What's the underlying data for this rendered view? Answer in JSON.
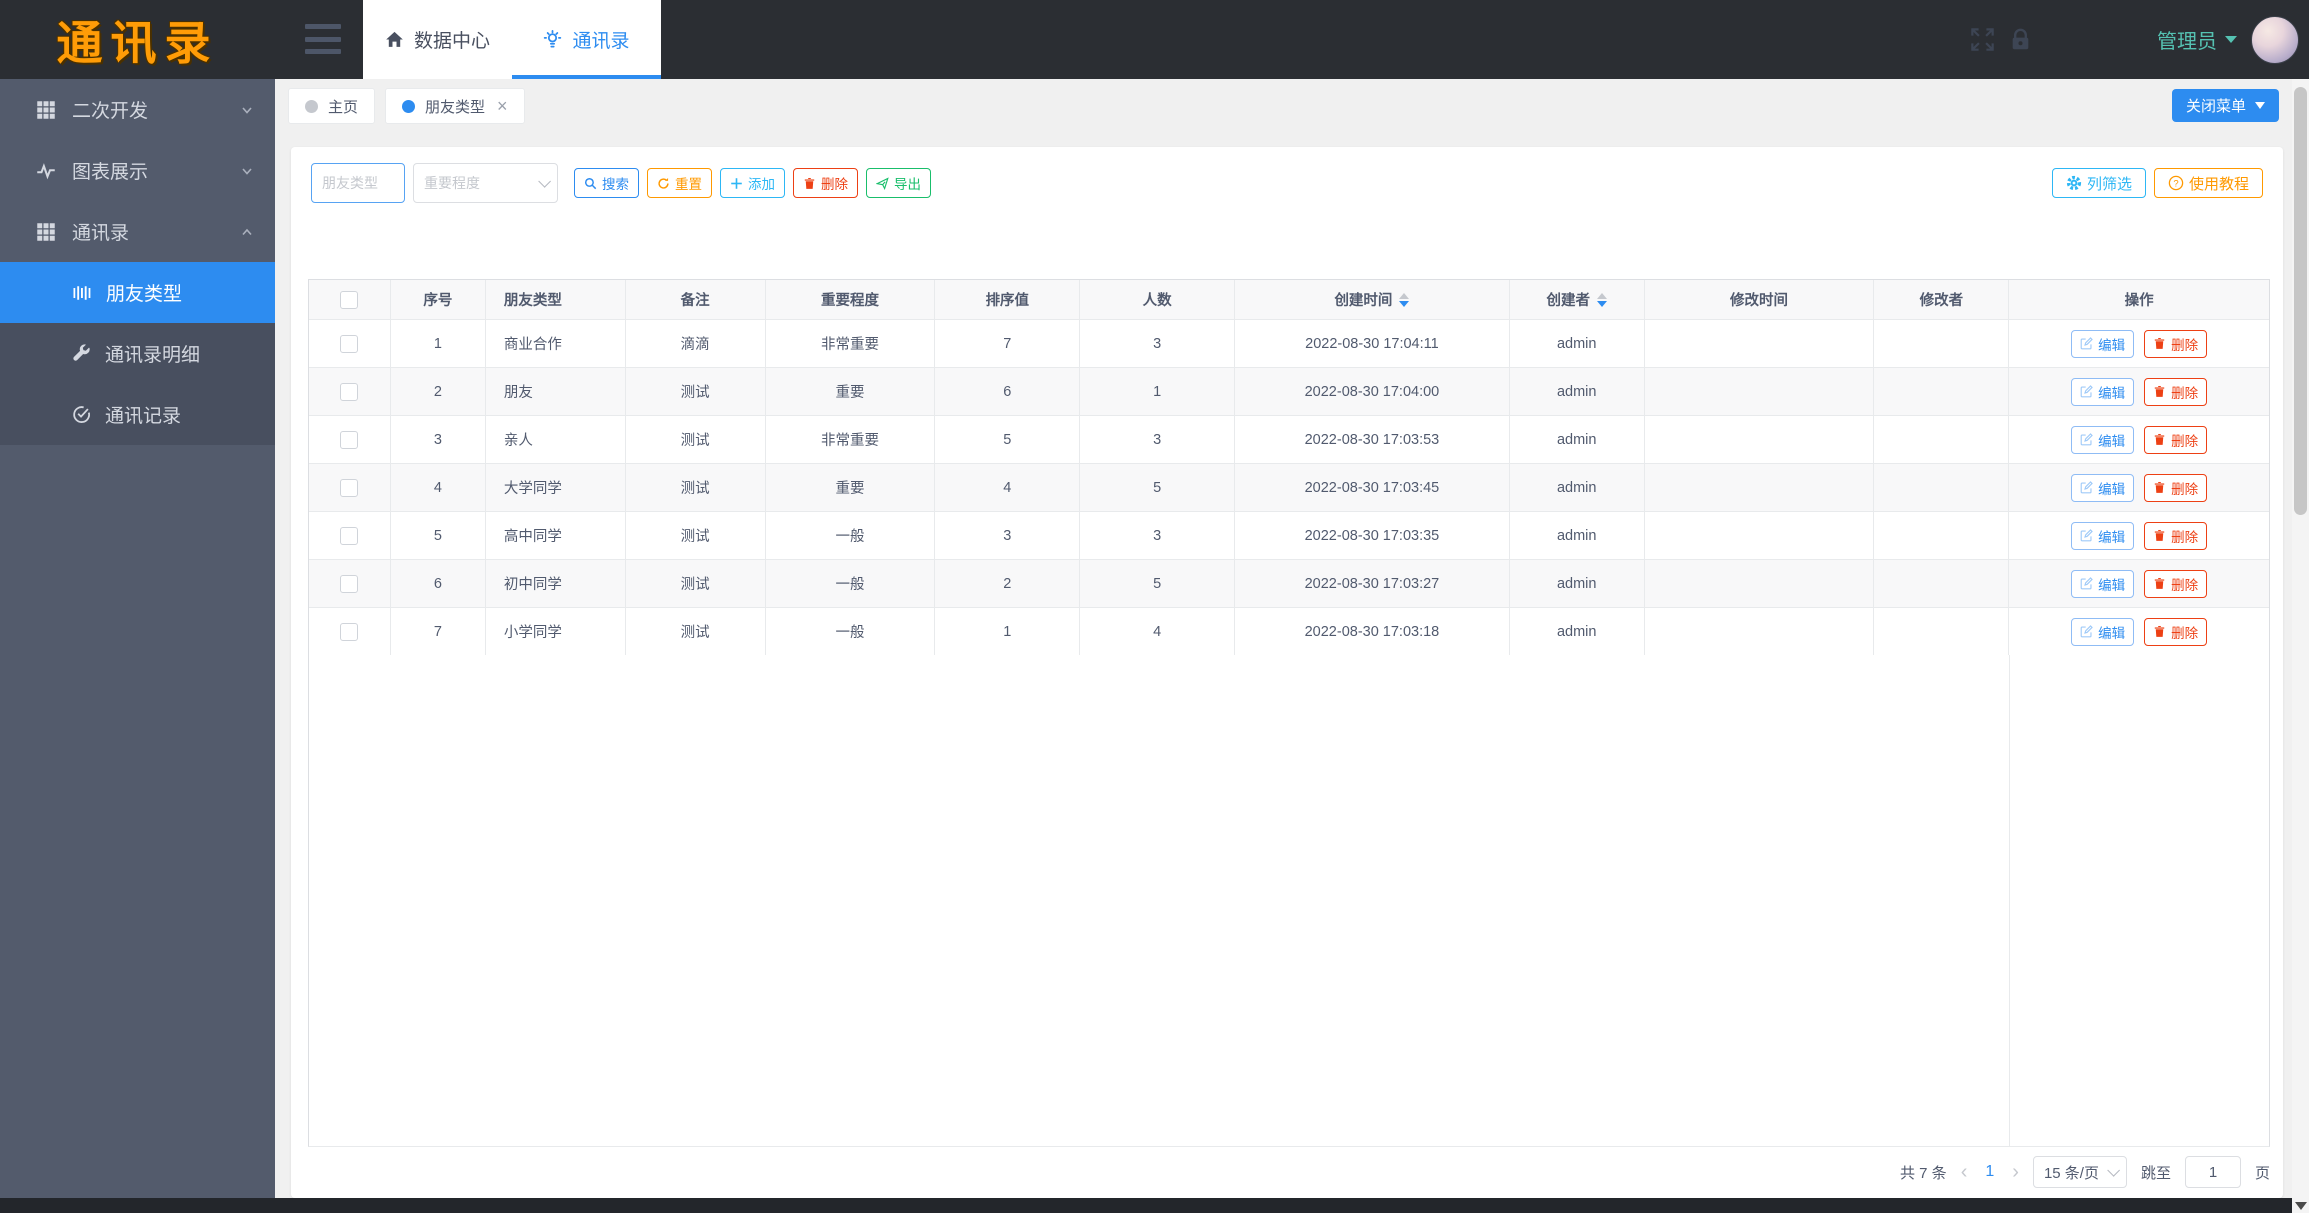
{
  "app": {
    "logo": "通讯录"
  },
  "top_nav": {
    "menu_tabs": [
      {
        "label": "数据中心"
      },
      {
        "label": "通讯录",
        "active": true
      }
    ],
    "user_name": "管理员"
  },
  "sidebar": {
    "items": [
      {
        "label": "二次开发",
        "icon": "grid-icon"
      },
      {
        "label": "图表展示",
        "icon": "pulse-icon"
      },
      {
        "label": "通讯录",
        "icon": "grid-icon",
        "expanded": true,
        "children": [
          {
            "label": "朋友类型",
            "icon": "barcode-icon",
            "active": true
          },
          {
            "label": "通讯录明细",
            "icon": "wrench-icon"
          },
          {
            "label": "通讯记录",
            "icon": "check-circle-icon"
          }
        ]
      }
    ]
  },
  "tag_bar": {
    "tags": [
      {
        "label": "主页"
      },
      {
        "label": "朋友类型",
        "active": true,
        "closable": true
      }
    ],
    "close_icon": "×",
    "close_menu_label": "关闭菜单"
  },
  "toolbar": {
    "type_placeholder": "朋友类型",
    "importance_placeholder": "重要程度",
    "search_label": "搜索",
    "reset_label": "重置",
    "add_label": "添加",
    "delete_label": "删除",
    "export_label": "导出",
    "column_filter_label": "列筛选",
    "tutorial_label": "使用教程"
  },
  "table": {
    "columns": [
      "序号",
      "朋友类型",
      "备注",
      "重要程度",
      "排序值",
      "人数",
      "创建时间",
      "创建者",
      "修改时间",
      "修改者",
      "操作"
    ],
    "edit_label": "编辑",
    "delete_label": "删除",
    "rows": [
      {
        "seq": "1",
        "type": "商业合作",
        "remark": "滴滴",
        "importance": "非常重要",
        "sort": "7",
        "count": "3",
        "created_at": "2022-08-30 17:04:11",
        "created_by": "admin",
        "updated_at": "",
        "updated_by": ""
      },
      {
        "seq": "2",
        "type": "朋友",
        "remark": "测试",
        "importance": "重要",
        "sort": "6",
        "count": "1",
        "created_at": "2022-08-30 17:04:00",
        "created_by": "admin",
        "updated_at": "",
        "updated_by": ""
      },
      {
        "seq": "3",
        "type": "亲人",
        "remark": "测试",
        "importance": "非常重要",
        "sort": "5",
        "count": "3",
        "created_at": "2022-08-30 17:03:53",
        "created_by": "admin",
        "updated_at": "",
        "updated_by": ""
      },
      {
        "seq": "4",
        "type": "大学同学",
        "remark": "测试",
        "importance": "重要",
        "sort": "4",
        "count": "5",
        "created_at": "2022-08-30 17:03:45",
        "created_by": "admin",
        "updated_at": "",
        "updated_by": ""
      },
      {
        "seq": "5",
        "type": "高中同学",
        "remark": "测试",
        "importance": "一般",
        "sort": "3",
        "count": "3",
        "created_at": "2022-08-30 17:03:35",
        "created_by": "admin",
        "updated_at": "",
        "updated_by": ""
      },
      {
        "seq": "6",
        "type": "初中同学",
        "remark": "测试",
        "importance": "一般",
        "sort": "2",
        "count": "5",
        "created_at": "2022-08-30 17:03:27",
        "created_by": "admin",
        "updated_at": "",
        "updated_by": ""
      },
      {
        "seq": "7",
        "type": "小学同学",
        "remark": "测试",
        "importance": "一般",
        "sort": "1",
        "count": "4",
        "created_at": "2022-08-30 17:03:18",
        "created_by": "admin",
        "updated_at": "",
        "updated_by": ""
      }
    ]
  },
  "pagination": {
    "total_label": "共 7 条",
    "prev": "‹",
    "current_page": "1",
    "next": "›",
    "page_size": "15 条/页",
    "jump_label": "跳至",
    "jump_value": "1",
    "page_unit": "页"
  },
  "colors": {
    "primary_blue": "#2d8cf0",
    "info_blue": "#2db7f5",
    "warning_orange": "#ff9900",
    "error_red": "#ed4014",
    "success_green": "#19be6b",
    "sidebar_bg": "#535b6c",
    "header_bg": "#2b2e33",
    "logo_orange": "#ff9c07",
    "username_teal": "#55c2b2"
  }
}
